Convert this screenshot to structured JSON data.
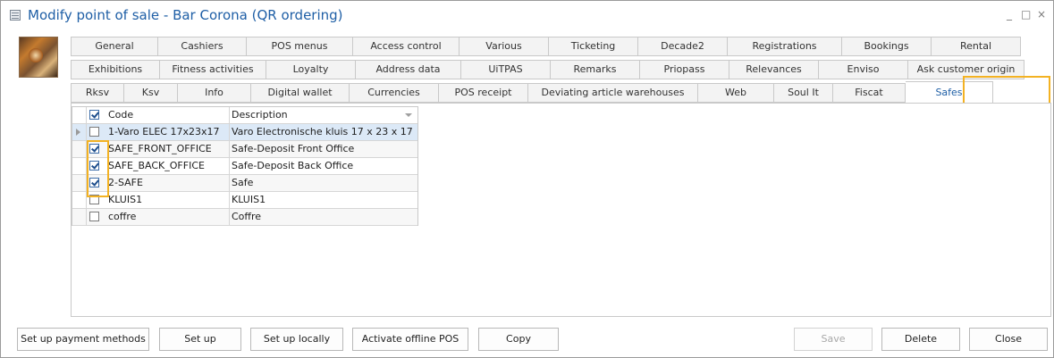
{
  "window": {
    "title": "Modify point of sale - Bar Corona (QR ordering)",
    "controls": [
      "_",
      "□",
      "×"
    ]
  },
  "tabs": {
    "row1": [
      "General",
      "Cashiers",
      "POS menus",
      "Access control",
      "Various",
      "Ticketing",
      "Decade2",
      "Registrations",
      "Bookings",
      "Rental"
    ],
    "row2": [
      "Exhibitions",
      "Fitness activities",
      "Loyalty",
      "Address data",
      "UiTPAS",
      "Remarks",
      "Priopass",
      "Relevances",
      "Enviso",
      "Ask customer origin"
    ],
    "row3": [
      "Rksv",
      "Ksv",
      "Info",
      "Digital wallet",
      "Currencies",
      "POS receipt",
      "Deviating article warehouses",
      "Web",
      "Soul It",
      "Fiscat",
      "Safes"
    ],
    "active": "Safes"
  },
  "grid": {
    "columns": {
      "code": "Code",
      "description": "Description"
    },
    "header_checked": true,
    "rows": [
      {
        "code": "1-Varo ELEC 17x23x17",
        "description": "Varo Electronische kluis 17 x 23 x 17",
        "checked": false,
        "current": true
      },
      {
        "code": "SAFE_FRONT_OFFICE",
        "description": "Safe-Deposit Front Office",
        "checked": true,
        "current": false
      },
      {
        "code": "SAFE_BACK_OFFICE",
        "description": "Safe-Deposit Back Office",
        "checked": true,
        "current": false
      },
      {
        "code": "2-SAFE",
        "description": "Safe",
        "checked": true,
        "current": false
      },
      {
        "code": "KLUIS1",
        "description": "KLUIS1",
        "checked": false,
        "current": false
      },
      {
        "code": "coffre",
        "description": "Coffre",
        "checked": false,
        "current": false
      }
    ]
  },
  "footer": {
    "set_up_payment_methods": "Set up payment methods",
    "set_up": "Set up",
    "set_up_locally": "Set up locally",
    "activate_offline_pos": "Activate offline POS",
    "copy": "Copy",
    "save": "Save",
    "delete": "Delete",
    "close": "Close"
  },
  "colors": {
    "title": "#1f5fa6",
    "highlight": "#f3b223",
    "active_tab_text": "#1f5fa6"
  }
}
